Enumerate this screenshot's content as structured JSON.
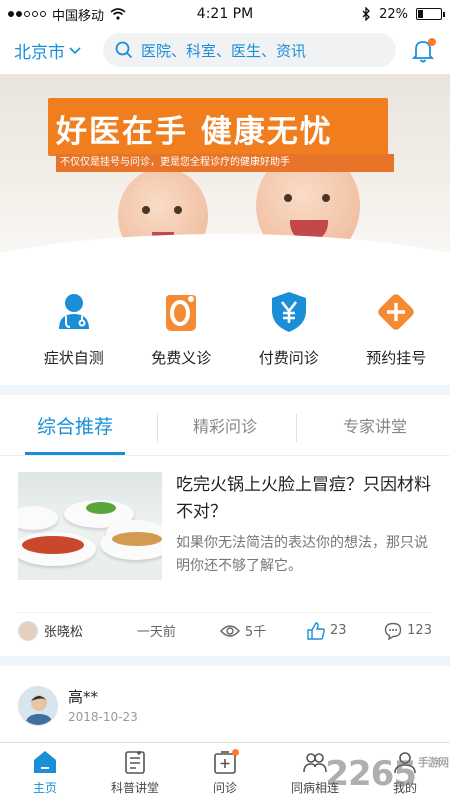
{
  "status_bar": {
    "carrier": "中国移动",
    "time": "4:21 PM",
    "battery": "22%"
  },
  "header": {
    "city": "北京市",
    "search_placeholder": "医院、科室、医生、资讯"
  },
  "banner": {
    "headline": "好医在手 健康无忧",
    "subline": "不仅仅是挂号与问诊，更是您全程诊疗的健康好助手",
    "indicator_count": 3,
    "active_index": 1
  },
  "quick_menu": [
    {
      "label": "症状自测",
      "icon": "stethoscope-icon"
    },
    {
      "label": "免费义诊",
      "icon": "zero-badge-icon"
    },
    {
      "label": "付费问诊",
      "icon": "yuan-shield-icon"
    },
    {
      "label": "预约挂号",
      "icon": "plus-diamond-icon"
    }
  ],
  "tabs": [
    {
      "label": "综合推荐",
      "active": true
    },
    {
      "label": "精彩问诊",
      "active": false
    },
    {
      "label": "专家讲堂",
      "active": false
    }
  ],
  "article": {
    "title": "吃完火锅上火脸上冒痘？只因材料不对？",
    "desc": "如果你无法简洁的表达你的想法，那只说明你还不够了解它。",
    "author": "张晓松",
    "time": "一天前",
    "views": "5千",
    "likes": "23",
    "comments": "123"
  },
  "post": {
    "name": "高**",
    "date": "2018-10-23"
  },
  "bottom_nav": [
    {
      "label": "主页",
      "icon": "home-icon",
      "active": true
    },
    {
      "label": "科普讲堂",
      "icon": "notes-icon",
      "active": false
    },
    {
      "label": "问诊",
      "icon": "consult-icon",
      "active": false,
      "badge": true
    },
    {
      "label": "同病相连",
      "icon": "community-icon",
      "active": false
    },
    {
      "label": "我的",
      "icon": "profile-icon",
      "active": false
    }
  ],
  "watermark": {
    "text": "2265",
    "sub": "手游网"
  },
  "colors": {
    "accent": "#1a8fd8",
    "orange": "#f07d1e",
    "badge": "#ff7a2b"
  }
}
